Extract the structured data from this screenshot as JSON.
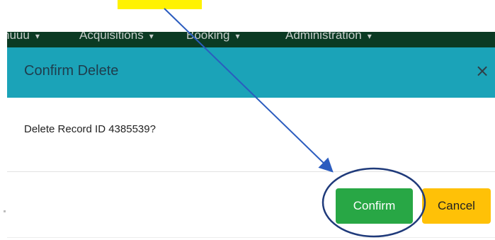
{
  "navbar": {
    "items": [
      {
        "label": "nuuu"
      },
      {
        "label": "Acquisitions"
      },
      {
        "label": "Booking"
      },
      {
        "label": "Administration"
      }
    ],
    "caret": "▾"
  },
  "modal": {
    "title": "Confirm Delete",
    "close_label": "×",
    "body_text": "Delete Record ID 4385539?",
    "confirm_label": "Confirm",
    "cancel_label": "Cancel"
  },
  "colors": {
    "header_bg": "#1ba3b8",
    "navbar_bg": "#0b3a23",
    "confirm_bg": "#28a745",
    "cancel_bg": "#ffc107",
    "highlight": "#fff200",
    "annotation": "#2b5cbf",
    "circle": "#1f3a7a"
  }
}
